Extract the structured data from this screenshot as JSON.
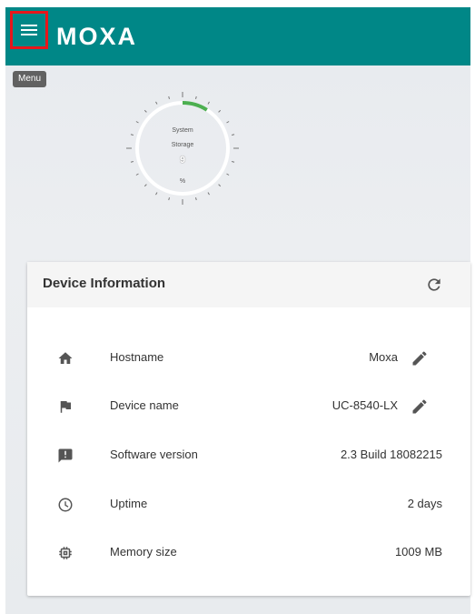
{
  "header": {
    "brand": "MOXA",
    "menu_tooltip": "Menu"
  },
  "gauge": {
    "title": "System",
    "subtitle": "Storage",
    "value": "9",
    "unit": "%",
    "value_percent": 9,
    "accent_color": "#4caf50"
  },
  "device_info": {
    "title": "Device Information",
    "rows": [
      {
        "icon": "home-icon",
        "label": "Hostname",
        "value": "Moxa",
        "editable": true
      },
      {
        "icon": "flag-icon",
        "label": "Device name",
        "value": "UC-8540-LX",
        "editable": true
      },
      {
        "icon": "alert-icon",
        "label": "Software version",
        "value": "2.3 Build 18082215",
        "editable": false
      },
      {
        "icon": "clock-icon",
        "label": "Uptime",
        "value": "2 days",
        "editable": false
      },
      {
        "icon": "chip-icon",
        "label": "Memory size",
        "value": "1009 MB",
        "editable": false
      }
    ]
  },
  "colors": {
    "topbar": "#008787",
    "highlight": "#e8161b"
  }
}
